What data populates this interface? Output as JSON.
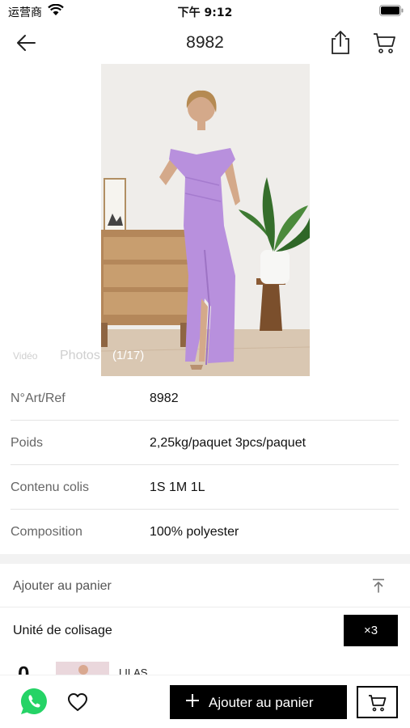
{
  "status_bar": {
    "carrier": "运营商",
    "time": "下午 9:12"
  },
  "header": {
    "title": "8982",
    "icons": [
      "back-arrow-icon",
      "share-icon",
      "cart-icon"
    ]
  },
  "media": {
    "tab_video": "Vidéo",
    "tab_photos": "Photos",
    "counter": "(1/17)"
  },
  "specs": [
    {
      "label": "N°Art/Ref",
      "value": "8982"
    },
    {
      "label": "Poids",
      "value": "2,25kg/paquet 3pcs/paquet"
    },
    {
      "label": "Contenu colis",
      "value": "1S 1M 1L"
    },
    {
      "label": "Composition",
      "value": "100% polyester"
    }
  ],
  "add_section": {
    "title": "Ajouter au panier",
    "unit_label": "Unité de colisage",
    "multiplier": "×3"
  },
  "variant": {
    "qty": "0",
    "name": "LILAS"
  },
  "bottom_bar": {
    "add_label": "Ajouter au panier"
  },
  "colors": {
    "accent": "#000000",
    "whatsapp": "#25D366",
    "dress": "#b890dd"
  }
}
